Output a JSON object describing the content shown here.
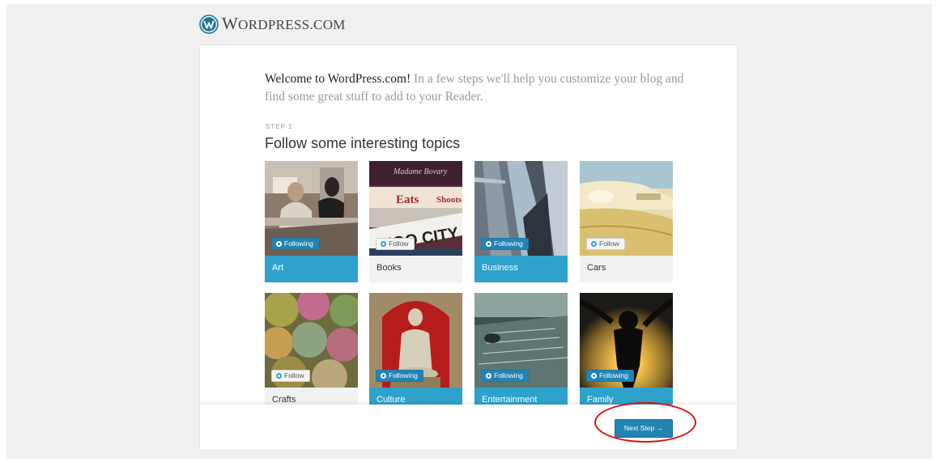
{
  "brand": {
    "logo_text": "WordPress.com"
  },
  "intro": {
    "lead": "Welcome to WordPress.com!",
    "rest": " In a few steps we'll help you customize your blog and find some great stuff to add to your Reader."
  },
  "step": {
    "label": "STEP 1",
    "title": "Follow some interesting topics"
  },
  "topics": [
    {
      "name": "Art",
      "button": "Following",
      "following": true
    },
    {
      "name": "Books",
      "button": "Follow",
      "following": false
    },
    {
      "name": "Business",
      "button": "Following",
      "following": true
    },
    {
      "name": "Cars",
      "button": "Follow",
      "following": false
    },
    {
      "name": "Crafts",
      "button": "Follow",
      "following": false
    },
    {
      "name": "Culture",
      "button": "Following",
      "following": true
    },
    {
      "name": "Entertainment",
      "button": "Following",
      "following": true
    },
    {
      "name": "Family",
      "button": "Following",
      "following": true
    }
  ],
  "book_cover": {
    "title": "Madame Bovary",
    "words": [
      "Eats",
      "Shoots"
    ],
    "sign": "ZOO CITY"
  },
  "footer": {
    "next_label": "Next Step →"
  },
  "colors": {
    "accent": "#2ea2cc",
    "button": "#2384b4",
    "highlight": "#e01010"
  }
}
